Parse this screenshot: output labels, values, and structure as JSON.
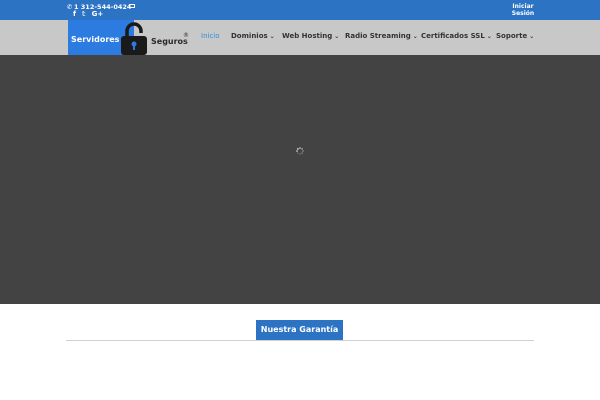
{
  "topbar": {
    "phone": "1 312-544-0424",
    "social_icons": [
      "facebook-icon",
      "twitter-icon",
      "google-plus-icon"
    ],
    "social_glyphs": [
      "f",
      "𝕥",
      "G+"
    ],
    "login_line1": "Iniciar",
    "login_line2": "Sesión"
  },
  "logo": {
    "text_left": "Servidores",
    "text_right": "Seguros",
    "registered": "®"
  },
  "nav": {
    "items": [
      {
        "label": "Inicio",
        "active": true
      },
      {
        "label": "Dominios",
        "active": false
      },
      {
        "label": "Web Hosting",
        "active": false
      },
      {
        "label": "Radio Streaming",
        "active": false
      },
      {
        "label": "Certificados SSL",
        "active": false
      },
      {
        "label": "Soporte",
        "active": false
      }
    ],
    "chevron": "⌄"
  },
  "section": {
    "title": "Nuestra Garantía"
  },
  "colors": {
    "topbar": "#2d73c4",
    "navbar": "#c8c8c8",
    "hero": "#434343",
    "active_link": "#2d8fe0"
  }
}
